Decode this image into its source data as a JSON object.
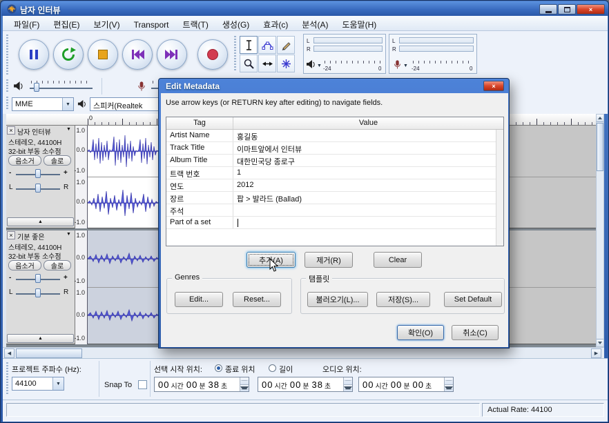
{
  "window": {
    "title": "남자 인터뷰"
  },
  "menu": [
    "파일(F)",
    "편집(E)",
    "보기(V)",
    "Transport",
    "트랙(T)",
    "생성(G)",
    "효과(c)",
    "분석(A)",
    "도움말(H)"
  ],
  "meters": {
    "left_label": "L",
    "right_label": "R",
    "scale_min": "-24",
    "scale_max": "0"
  },
  "devices": {
    "host": "MME",
    "output": "스피커(Realtek"
  },
  "timeline": {
    "origin_label": "0"
  },
  "ruler": [
    "1.0",
    "0.0",
    "-1.0"
  ],
  "tracks": [
    {
      "name": "남자 인터뷰",
      "format_line": "스테레오, 44100H",
      "depth_line": "32-bit 부동 소수점",
      "mute": "음소거",
      "solo": "솔로",
      "gain_min": "-",
      "gain_max": "+",
      "pan_left": "L",
      "pan_right": "R"
    },
    {
      "name": "기분 좋은",
      "format_line": "스테레오, 44100H",
      "depth_line": "32-bit 부동 소수점",
      "mute": "음소거",
      "solo": "솔로",
      "gain_min": "-",
      "gain_max": "+",
      "pan_left": "L",
      "pan_right": "R"
    }
  ],
  "dialog": {
    "title": "Edit Metadata",
    "instruction": "Use arrow keys (or RETURN key after editing) to navigate fields.",
    "columns": {
      "tag": "Tag",
      "value": "Value"
    },
    "rows": [
      {
        "tag": "Artist Name",
        "value": "홍길동"
      },
      {
        "tag": "Track Title",
        "value": "이마트앞에서 인터뷰"
      },
      {
        "tag": "Album Title",
        "value": "대한민국당 종로구"
      },
      {
        "tag": "트랙 번호",
        "value": "1"
      },
      {
        "tag": "연도",
        "value": "2012"
      },
      {
        "tag": "장르",
        "value": "팝 > 발라드 (Ballad)"
      },
      {
        "tag": "주석",
        "value": ""
      },
      {
        "tag": "Part of a set",
        "value": ""
      }
    ],
    "buttons": {
      "add": "추가(A)",
      "remove": "제거(R)",
      "clear": "Clear"
    },
    "genres": {
      "label": "Genres",
      "edit": "Edit...",
      "reset": "Reset..."
    },
    "templates": {
      "label": "탬플릿",
      "load": "불러오기(L)...",
      "save": "저장(S)...",
      "set_default": "Set Default"
    },
    "footer": {
      "ok": "확인(O)",
      "cancel": "취소(C)"
    }
  },
  "selection_bar": {
    "rate_label": "프로젝트 주파수 (Hz):",
    "rate_value": "44100",
    "snap_label": "Snap To",
    "selection_start_label": "선택 시작 위치:",
    "end_option": "종료 위치",
    "length_option": "길이",
    "audio_position_label": "오디오 위치:",
    "units": {
      "hour": "시간",
      "minute": "분",
      "second": "초"
    },
    "selection_start": {
      "h": "00",
      "m": "00",
      "s": "38"
    },
    "selection_end": {
      "h": "00",
      "m": "00",
      "s": "38"
    },
    "audio_position": {
      "h": "00",
      "m": "00",
      "s": "00"
    }
  },
  "status": {
    "actual_rate": "Actual Rate: 44100"
  }
}
